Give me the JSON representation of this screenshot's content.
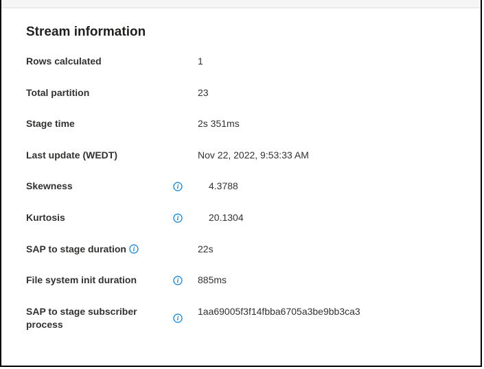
{
  "section": {
    "title": "Stream information"
  },
  "rows": {
    "rows_calculated": {
      "label": "Rows calculated",
      "value": "1"
    },
    "total_partition": {
      "label": "Total partition",
      "value": "23"
    },
    "stage_time": {
      "label": "Stage time",
      "value": "2s 351ms"
    },
    "last_update": {
      "label": "Last update (WEDT)",
      "value": "Nov 22, 2022, 9:53:33 AM"
    },
    "skewness": {
      "label": "Skewness",
      "value": "4.3788"
    },
    "kurtosis": {
      "label": "Kurtosis",
      "value": "20.1304"
    },
    "sap_to_stage_duration": {
      "label": "SAP to stage duration",
      "value": "22s"
    },
    "fs_init_duration": {
      "label": "File system init duration",
      "value": "885ms"
    },
    "sap_subscriber": {
      "label": "SAP to stage subscriber process",
      "value": "1aa69005f3f14fbba6705a3be9bb3ca3"
    }
  }
}
